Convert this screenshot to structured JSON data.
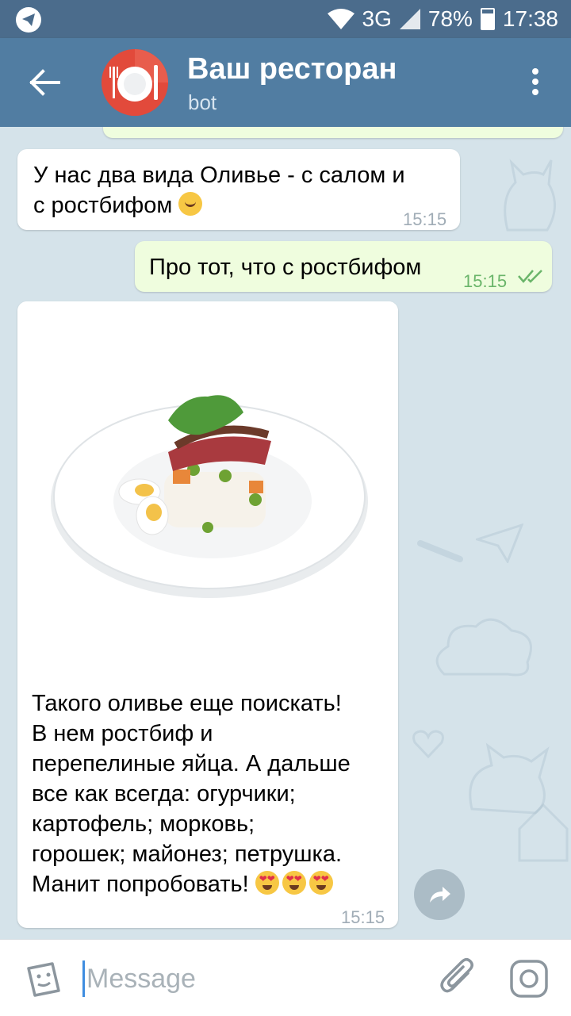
{
  "status": {
    "network": "3G",
    "battery": "78%",
    "battery_level": 0.78,
    "time": "17:38"
  },
  "header": {
    "title": "Ваш ресторан",
    "subtitle": "bot"
  },
  "messages": [
    {
      "direction": "in",
      "lines": [
        "У нас два вида Оливье - с салом и",
        "с ростбифом"
      ],
      "emoji": "hugging-face",
      "time": "15:15"
    },
    {
      "direction": "out",
      "text": "Про тот, что с ростбифом",
      "time": "15:15",
      "read": true
    },
    {
      "direction": "in",
      "type": "photo",
      "photo_alt": "Olivier salad with roast beef and quail eggs on a white plate",
      "lines": [
        "Такого оливье еще поискать!",
        "В нем ростбиф и",
        "перепелиные яйца. А дальше",
        "все как всегда: огурчики;",
        "картофель; морковь;",
        "горошек; майонез; петрушка.",
        "Манит попробовать!"
      ],
      "emoji": "heart-eyes x3",
      "time": "15:15"
    }
  ],
  "input": {
    "placeholder": "Message"
  },
  "colors": {
    "header": "#517da2",
    "statusbar": "#4b6c8c",
    "chat_bg": "#d5e3ea",
    "out_bubble": "#effdde",
    "accent_time": "#6ab56a"
  }
}
